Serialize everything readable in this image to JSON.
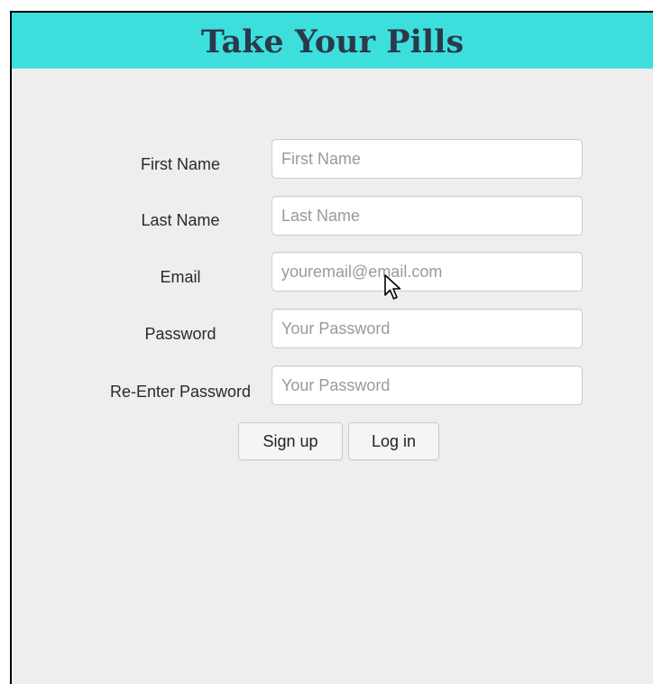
{
  "app": {
    "title": "Take Your Pills"
  },
  "form": {
    "fields": [
      {
        "label": "First Name",
        "placeholder": "First Name",
        "value": ""
      },
      {
        "label": "Last Name",
        "placeholder": "Last Name",
        "value": ""
      },
      {
        "label": "Email",
        "placeholder": "youremail@email.com",
        "value": ""
      },
      {
        "label": "Password",
        "placeholder": "Your Password",
        "value": ""
      },
      {
        "label": "Re-Enter Password",
        "placeholder": "Your Password",
        "value": ""
      }
    ],
    "buttons": {
      "signup": "Sign up",
      "login": "Log in"
    }
  },
  "colors": {
    "header_bg": "#3ddfdd",
    "title_text": "#2a3a4a",
    "page_bg": "#eeeeee"
  },
  "icons": {
    "cursor": "mouse-pointer-icon"
  }
}
